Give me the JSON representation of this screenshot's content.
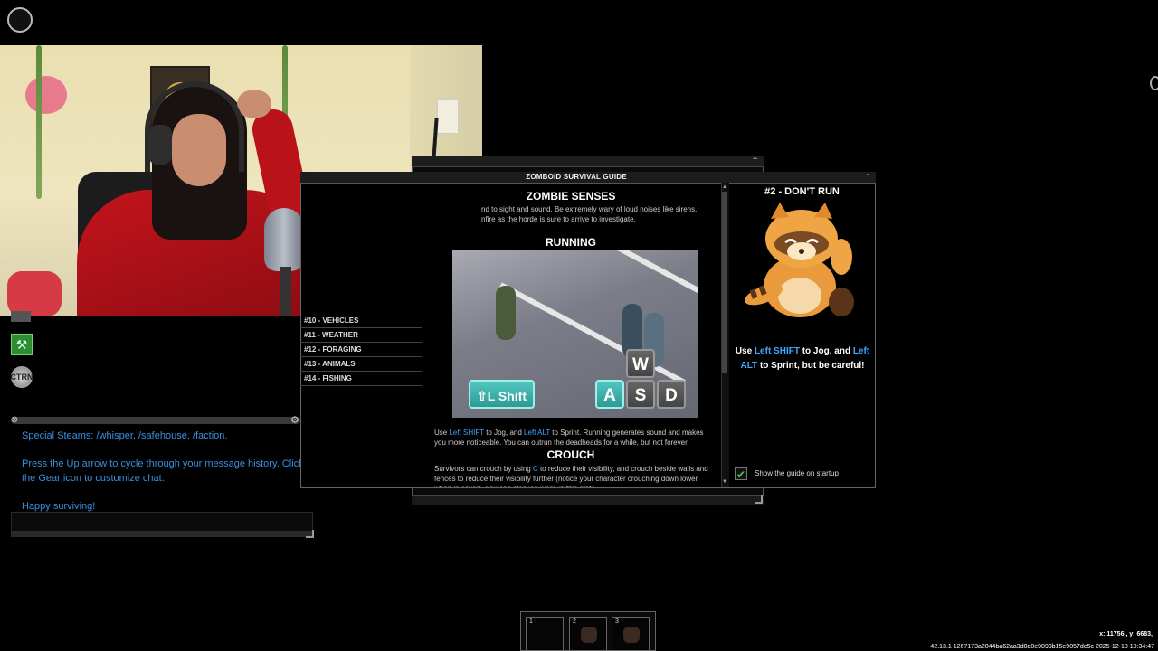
{
  "chat": {
    "lines": [
      "Special Steams: /whisper, /safehouse, /faction.",
      "Press the Up arrow to cycle through your message history. Click the Gear icon to customize chat.",
      "Happy surviving!"
    ],
    "close_glyph": "⊗",
    "gear_glyph": "⚙"
  },
  "sidebar_icons": [
    {
      "name": "crafting-icon",
      "glyph": "⚒"
    },
    {
      "name": "clothing-icon",
      "glyph": "CTRN"
    }
  ],
  "guide": {
    "title": "ZOMBOID SURVIVAL GUIDE",
    "nav_items": [
      "#10 - VEHICLES",
      "#11 - WEATHER",
      "#12 - FORAGING",
      "#13 - ANIMALS",
      "#14 - FISHING"
    ],
    "sections": {
      "senses_title": "ZOMBIE SENSES",
      "senses_text_1": "nd to sight and sound. Be extremely wary of loud noises like sirens,",
      "senses_text_2": "nfire as the horde is sure to arrive to investigate.",
      "running_title": "RUNNING",
      "running_text_pre": "Use ",
      "running_key1": "Left SHIFT",
      "running_text_mid": " to Jog, and ",
      "running_key2": "Left ALT",
      "running_text_post": " to Sprint. Running generates sound and makes you more noticeable. You can outrun the deadheads for a while, but not forever.",
      "crouch_title": "CROUCH",
      "crouch_text_pre": "Survivors can crouch by using ",
      "crouch_key": "C",
      "crouch_text_post": " to reduce their visibility, and crouch beside walls and fences to reduce their visibility further (notice your character crouching down lower when in cover). You can also jog while in this state."
    },
    "keys": {
      "shift": "⇧L Shift",
      "w": "W",
      "a": "A",
      "s": "S",
      "d": "D"
    },
    "tip": {
      "title": "#2 - DON'T RUN",
      "text_pre": "Use ",
      "key1": "Left SHIFT",
      "text_mid": " to Jog, and ",
      "key2": "Left ALT",
      "text_post": " to Sprint, but be careful!",
      "checkbox_label": "Show the guide on startup",
      "checkbox_checked": true,
      "check_glyph": "✔"
    },
    "pin_glyph": "⍑"
  },
  "hotbar": {
    "slots": [
      "1",
      "2",
      "3"
    ]
  },
  "status": {
    "coords": "x: 11756 , y: 6683,",
    "build": "42.13.1 1267173a2044ba62aa3d0a0e9899b15e9057de5c 2025-12-18 10:34:47"
  },
  "colors": {
    "chat_text": "#3a8fe0",
    "highlight": "#3fa8ff",
    "key_teal": "#3fb8b2"
  }
}
